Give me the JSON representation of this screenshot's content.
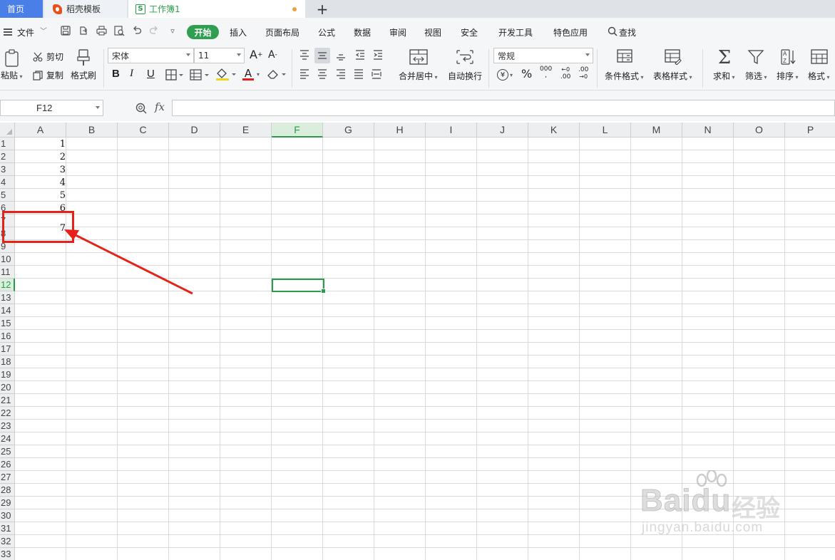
{
  "tabs": {
    "home": "首页",
    "templates": "稻壳模板",
    "workbook": "工作簿1",
    "new_tab": "+"
  },
  "menu": {
    "file": "文件",
    "items": [
      "开始",
      "插入",
      "页面布局",
      "公式",
      "数据",
      "审阅",
      "视图",
      "安全",
      "开发工具",
      "特色应用"
    ],
    "search": "查找"
  },
  "ribbon": {
    "paste": "粘贴",
    "cut": "剪切",
    "copy": "复制",
    "format_painter": "格式刷",
    "font_name": "宋体",
    "font_size": "11",
    "grow_font": "A",
    "shrink_font": "A",
    "bold": "B",
    "italic": "I",
    "underline": "U",
    "font_color_glyph": "A",
    "merge_center": "合并居中",
    "wrap_text": "自动换行",
    "number_format": "常规",
    "currency": "¥",
    "percent": "%",
    "thousands": "000",
    "inc_decimal": ".00",
    "dec_decimal": ".00",
    "conditional_format": "条件格式",
    "table_style": "表格样式",
    "sum": "求和",
    "filter": "筛选",
    "sort": "排序",
    "format": "格式"
  },
  "formula_bar": {
    "cell_ref": "F12",
    "fx": "fx",
    "formula": ""
  },
  "sheet": {
    "columns": [
      "A",
      "B",
      "C",
      "D",
      "E",
      "F",
      "G",
      "H",
      "I",
      "J",
      "K",
      "L",
      "M",
      "N",
      "O",
      "P"
    ],
    "selected_column": "F",
    "row_count": 33,
    "selected_row": 12,
    "values_col_a": [
      "1",
      "2",
      "3",
      "4",
      "5",
      "6",
      "7"
    ]
  },
  "watermark": {
    "logo": "Baidu",
    "jingyan": "经验",
    "url": "jingyan.baidu.com"
  },
  "colors": {
    "accent_green": "#30a050",
    "home_tab": "#4a7fe8",
    "annotation_red": "#e8201a"
  }
}
